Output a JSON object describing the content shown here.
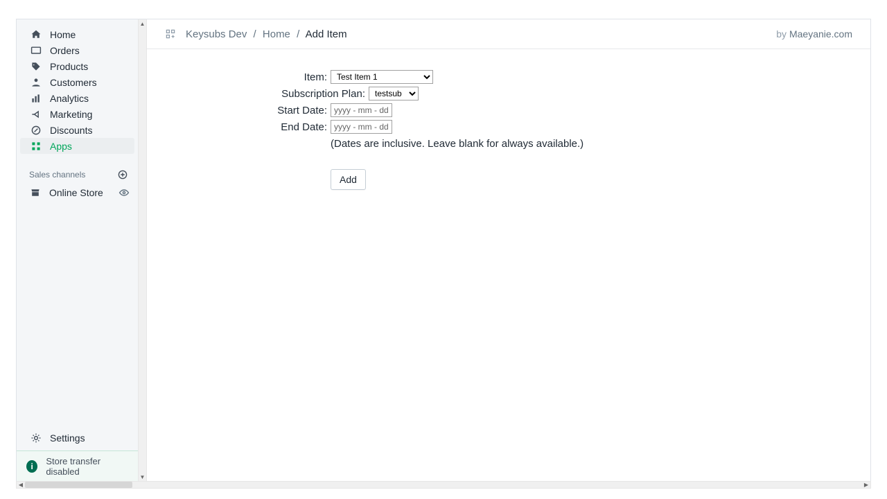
{
  "sidebar": {
    "items": [
      {
        "label": "Home"
      },
      {
        "label": "Orders"
      },
      {
        "label": "Products"
      },
      {
        "label": "Customers"
      },
      {
        "label": "Analytics"
      },
      {
        "label": "Marketing"
      },
      {
        "label": "Discounts"
      },
      {
        "label": "Apps"
      }
    ],
    "channels_heading": "Sales channels",
    "online_store": "Online Store",
    "settings": "Settings",
    "notice": "Store transfer disabled"
  },
  "header": {
    "crumb_app": "Keysubs Dev",
    "crumb_home": "Home",
    "crumb_current": "Add Item",
    "by_prefix": "by ",
    "by_author": "Maeyanie.com"
  },
  "form": {
    "item_label": "Item:",
    "item_value": "Test Item 1",
    "plan_label": "Subscription Plan:",
    "plan_value": "testsub",
    "start_label": "Start Date:",
    "end_label": "End Date:",
    "date_placeholder": "yyyy - mm - dd",
    "hint": "(Dates are inclusive. Leave blank for always available.)",
    "add_button": "Add"
  }
}
